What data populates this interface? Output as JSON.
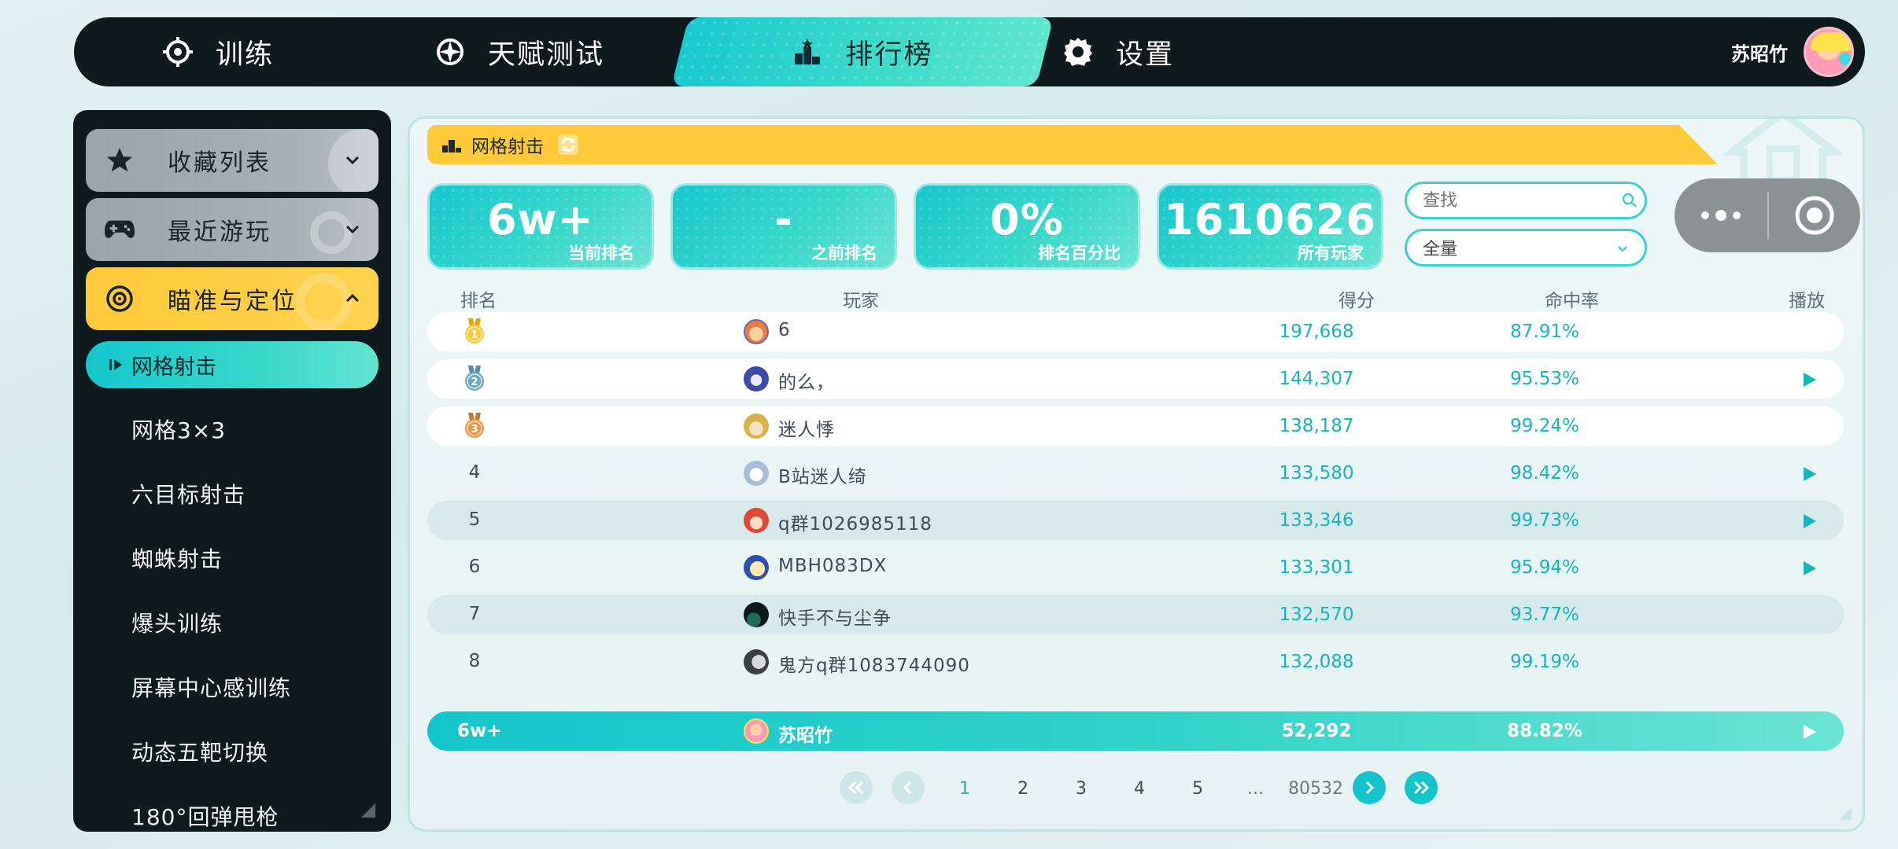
{
  "nav": {
    "tabs": [
      {
        "label": "训练",
        "icon": "crosshair-icon"
      },
      {
        "label": "天赋测试",
        "icon": "compass-icon"
      },
      {
        "label": "排行榜",
        "icon": "podium-icon",
        "active": true
      },
      {
        "label": "设置",
        "icon": "gear-icon"
      }
    ],
    "username": "苏昭竹"
  },
  "sidebar": {
    "categories": [
      {
        "label": "收藏列表",
        "icon": "star-icon",
        "expanded": false
      },
      {
        "label": "最近游玩",
        "icon": "gamepad-icon",
        "expanded": false
      },
      {
        "label": "瞄准与定位",
        "icon": "target-icon",
        "expanded": true
      }
    ],
    "active_item": "网格射击",
    "items": [
      "网格3×3",
      "六目标射击",
      "蜘蛛射击",
      "爆头训练",
      "屏幕中心感训练",
      "动态五靶切换",
      "180°回弹甩枪"
    ]
  },
  "leaderboard": {
    "title": "网格射击",
    "stats": [
      {
        "value": "6w+",
        "caption": "当前排名"
      },
      {
        "value": "-",
        "caption": "之前排名"
      },
      {
        "value": "0%",
        "caption": "排名百分比"
      },
      {
        "value": "1610626",
        "caption": "所有玩家"
      }
    ],
    "search_placeholder": "查找",
    "filter_value": "全量",
    "columns": {
      "rank": "排名",
      "player": "玩家",
      "score": "得分",
      "accuracy": "命中率",
      "replay": "播放"
    },
    "rows": [
      {
        "rank": "1",
        "name": "6",
        "score": "197,668",
        "accuracy": "87.91%",
        "replay": false
      },
      {
        "rank": "2",
        "name": "的么，",
        "score": "144,307",
        "accuracy": "95.53%",
        "replay": true
      },
      {
        "rank": "3",
        "name": "迷人悸",
        "score": "138,187",
        "accuracy": "99.24%",
        "replay": false
      },
      {
        "rank": "4",
        "name": "B站迷人绮",
        "score": "133,580",
        "accuracy": "98.42%",
        "replay": true
      },
      {
        "rank": "5",
        "name": "q群1026985118",
        "score": "133,346",
        "accuracy": "99.73%",
        "replay": true
      },
      {
        "rank": "6",
        "name": "MBH083DX",
        "score": "133,301",
        "accuracy": "95.94%",
        "replay": true
      },
      {
        "rank": "7",
        "name": "快手不与尘争",
        "score": "132,570",
        "accuracy": "93.77%",
        "replay": false
      },
      {
        "rank": "8",
        "name": "鬼方q群1083744090",
        "score": "132,088",
        "accuracy": "99.19%",
        "replay": false
      }
    ],
    "me": {
      "rank": "6w+",
      "name": "苏昭竹",
      "score": "52,292",
      "accuracy": "88.82%"
    },
    "pagination": {
      "pages": [
        "1",
        "2",
        "3",
        "4",
        "5"
      ],
      "ellipsis": "...",
      "last": "80532"
    }
  },
  "colors": {
    "accent": "#13c4cc",
    "yellow": "#ffc93a",
    "dark": "#0f1a1e"
  }
}
